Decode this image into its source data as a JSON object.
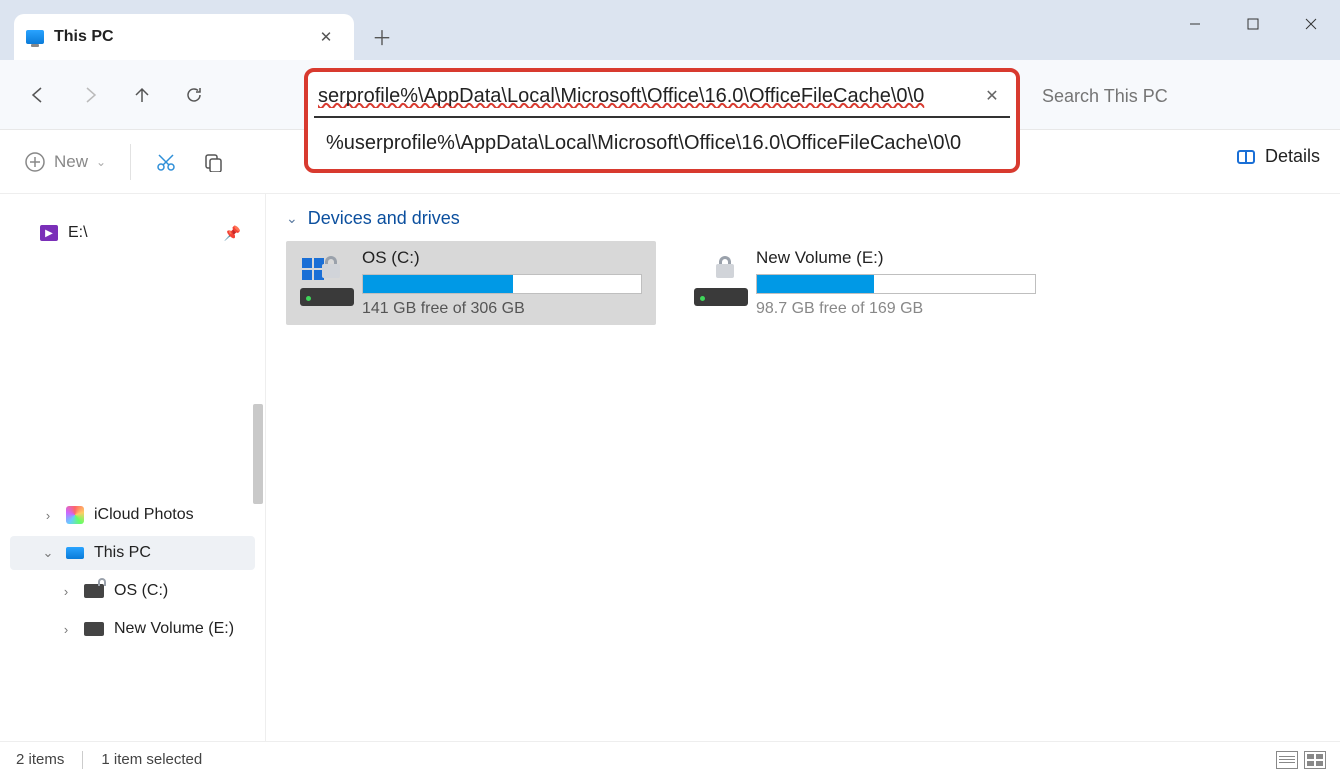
{
  "tab": {
    "title": "This PC"
  },
  "nav": {
    "address_value": "serprofile%\\AppData\\Local\\Microsoft\\Office\\16.0\\OfficeFileCache\\0\\0",
    "suggestion": "%userprofile%\\AppData\\Local\\Microsoft\\Office\\16.0\\OfficeFileCache\\0\\0",
    "search_placeholder": "Search This PC"
  },
  "ribbon": {
    "new_label": "New",
    "details_label": "Details"
  },
  "sidebar": {
    "pinned": {
      "label": "E:\\"
    },
    "items": [
      {
        "label": "iCloud Photos"
      },
      {
        "label": "This PC"
      },
      {
        "label": "OS (C:)"
      },
      {
        "label": "New Volume (E:)"
      }
    ]
  },
  "content": {
    "group_title": "Devices and drives",
    "drives": [
      {
        "name": "OS (C:)",
        "free_text": "141 GB free of 306 GB",
        "fill_pct": 54,
        "selected": true,
        "has_winlogo": true
      },
      {
        "name": "New Volume (E:)",
        "free_text": "98.7 GB free of 169 GB",
        "fill_pct": 42,
        "selected": false,
        "has_winlogo": false
      }
    ]
  },
  "status": {
    "count": "2 items",
    "selected": "1 item selected"
  }
}
